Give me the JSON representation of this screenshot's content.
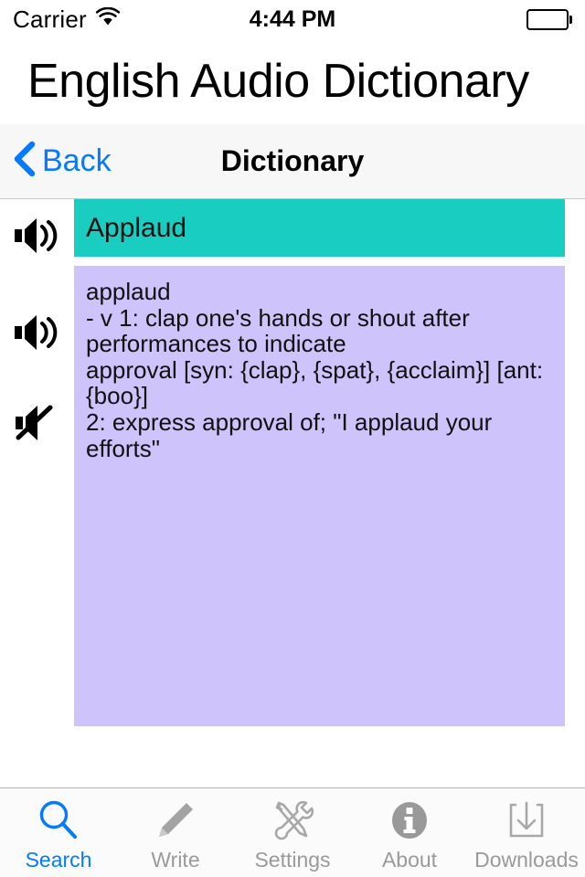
{
  "status_bar": {
    "carrier": "Carrier",
    "wifi_icon": "wifi-icon",
    "time": "4:44 PM",
    "battery_icon": "battery-full-icon"
  },
  "app": {
    "title": "English  Audio Dictionary"
  },
  "nav_bar": {
    "back_label": "Back",
    "back_chevron_icon": "chevron-left-icon",
    "title": "Dictionary"
  },
  "content": {
    "audio_controls": [
      {
        "icon": "speaker-wave-icon",
        "name": "play-word-audio"
      },
      {
        "icon": "speaker-wave-icon",
        "name": "play-definition-audio"
      },
      {
        "icon": "speaker-mute-icon",
        "name": "stop-audio"
      }
    ],
    "word_header": "Applaud",
    "definition": "applaud\n- v 1: clap one's hands or shout after\nperformances to indicate\napproval [syn: {clap}, {spat}, {acclaim}] [ant:\n{boo}]\n2: express approval of; \"I applaud your\nefforts\""
  },
  "tab_bar": {
    "items": [
      {
        "label": "Search",
        "icon": "magnifier-icon",
        "active": true
      },
      {
        "label": "Write",
        "icon": "pencil-icon",
        "active": false
      },
      {
        "label": "Settings",
        "icon": "tools-icon",
        "active": false
      },
      {
        "label": "About",
        "icon": "info-circle-icon",
        "active": false
      },
      {
        "label": "Downloads",
        "icon": "download-icon",
        "active": false
      }
    ]
  },
  "colors": {
    "word_header_bg": "#19cdc0",
    "definition_bg": "#cec3fb",
    "accent_blue": "#047aff",
    "inactive_gray": "#9a9a9a"
  }
}
